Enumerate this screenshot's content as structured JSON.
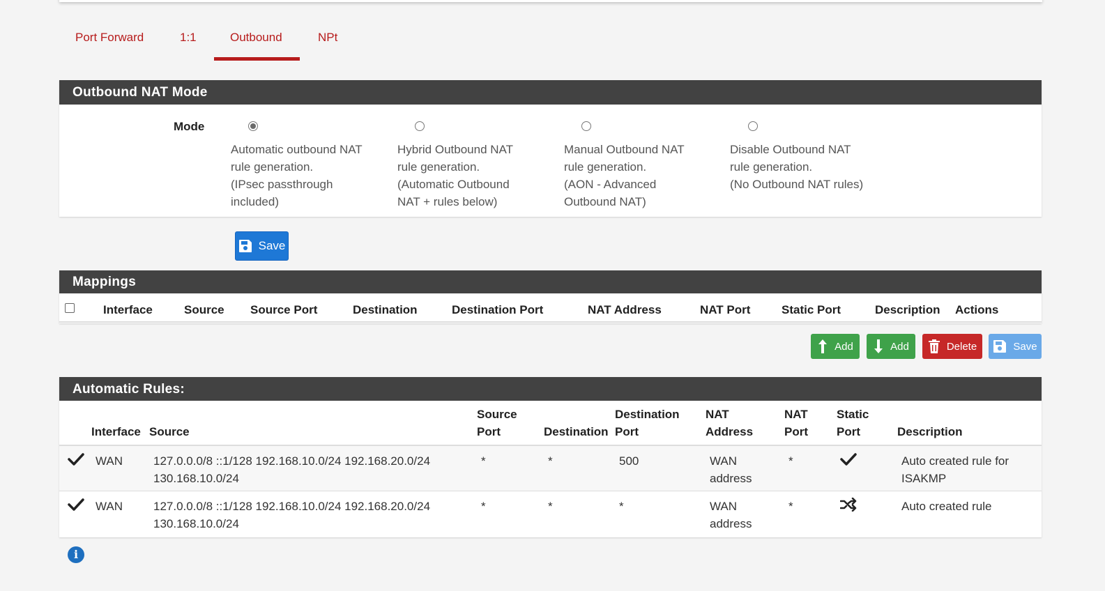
{
  "tabs": [
    {
      "label": "Port Forward",
      "active": false
    },
    {
      "label": "1:1",
      "active": false
    },
    {
      "label": "Outbound",
      "active": true
    },
    {
      "label": "NPt",
      "active": false
    }
  ],
  "outbound_mode": {
    "title": "Outbound NAT Mode",
    "mode_label": "Mode",
    "options": [
      {
        "label": "Automatic outbound NAT\nrule generation.\n(IPsec passthrough\nincluded)",
        "selected": true
      },
      {
        "label": "Hybrid Outbound NAT\nrule generation.\n(Automatic Outbound\nNAT + rules below)",
        "selected": false
      },
      {
        "label": "Manual Outbound NAT\nrule generation.\n(AON - Advanced\nOutbound NAT)",
        "selected": false
      },
      {
        "label": "Disable Outbound NAT\nrule generation.\n(No Outbound NAT rules)",
        "selected": false
      }
    ],
    "save_label": "Save"
  },
  "mappings": {
    "title": "Mappings",
    "columns": [
      "Interface",
      "Source",
      "Source Port",
      "Destination",
      "Destination Port",
      "NAT Address",
      "NAT Port",
      "Static Port",
      "Description",
      "Actions"
    ],
    "buttons": {
      "add_top": "Add",
      "add_bottom": "Add",
      "delete": "Delete",
      "save": "Save"
    }
  },
  "automatic_rules": {
    "title": "Automatic Rules:",
    "columns": {
      "interface": "Interface",
      "source": "Source",
      "source_port": "Source\nPort",
      "destination": "Destination",
      "destination_port": "Destination\nPort",
      "nat_address": "NAT\nAddress",
      "nat_port": "NAT\nPort",
      "static_port": "Static\nPort",
      "description": "Description"
    },
    "rows": [
      {
        "enabled_icon": "check-icon",
        "interface": "WAN",
        "source": "127.0.0.0/8 ::1/128 192.168.10.0/24 192.168.20.0/24\n130.168.10.0/24",
        "source_port": "*",
        "destination": "*",
        "destination_port": "500",
        "nat_address": "WAN\naddress",
        "nat_port": "*",
        "static_port_icon": "check-icon",
        "description": "Auto created rule for\nISAKMP"
      },
      {
        "enabled_icon": "check-icon",
        "interface": "WAN",
        "source": "127.0.0.0/8 ::1/128 192.168.10.0/24 192.168.20.0/24\n130.168.10.0/24",
        "source_port": "*",
        "destination": "*",
        "destination_port": "*",
        "nat_address": "WAN\naddress",
        "nat_port": "*",
        "static_port_icon": "shuffle-icon",
        "description": "Auto created rule"
      }
    ]
  },
  "colors": {
    "accent_red": "#b71c1c",
    "panel_header": "#424242",
    "primary_blue": "#1e78d6",
    "success_green": "#3fa24a",
    "danger_red": "#c62828",
    "info_blue": "#1e6fbf"
  }
}
